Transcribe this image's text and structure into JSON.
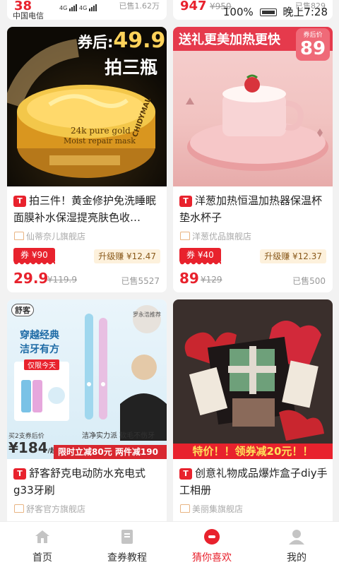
{
  "status_bar": {
    "carrier": "中国电信",
    "signal_1": "4G",
    "signal_2": "4G",
    "battery": "100%",
    "time": "晚上7:28"
  },
  "peek_row": [
    {
      "price": "38",
      "sold": "已售1.62万"
    },
    {
      "price": "947",
      "old_price": "¥950",
      "sold": "已售829"
    }
  ],
  "products": [
    {
      "title": "拍三件！黄金修护免洗睡眠面膜补水保湿提亮肤色收…",
      "shop": "仙蒂奈儿旗舰店",
      "coupon": "券 ¥90",
      "earn": "升级赚 ¥12.47",
      "price": "29.9",
      "old_price": "¥119.9",
      "sold": "已售5527",
      "banner_text_1": "券后:",
      "banner_text_2": "49.9",
      "banner_text_3": "拍三瓶",
      "jar_text": "24k pure gold",
      "jar_text_2": "Moist repair mask",
      "jar_brand": "CHIDYMAL"
    },
    {
      "title": "洋葱加热恒温加热器保温杯垫水杯子",
      "shop": "洋葱优品旗舰店",
      "coupon": "券 ¥40",
      "earn": "升级赚 ¥12.37",
      "price": "89",
      "old_price": "¥129",
      "sold": "已售500",
      "banner_text_1": "送礼更美加热更快",
      "badge_small": "券后价",
      "badge_big": "89"
    },
    {
      "title": "舒客舒克电动防水充电式g33牙刷",
      "shop": "舒客官方旗舰店",
      "banner_brand": "舒客",
      "banner_text_1": "穿越经典",
      "banner_text_2": "洁牙有方",
      "banner_text_3": "仅限今天",
      "banner_text_4": "买2支券后价",
      "banner_price": "¥184",
      "banner_price_unit": "/起",
      "banner_strip": "限时立减80元  两件减190",
      "banner_caption": "洁净实力派  软毛不伤牙",
      "banner_badge": "罗永浩推荐"
    },
    {
      "title": "创意礼物成品爆炸盒子diy手工相册",
      "shop": "美丽集旗舰店",
      "banner_strip": "特价！！领券减20元！！"
    }
  ],
  "tabbar": [
    {
      "label": "首页",
      "icon": "home-icon"
    },
    {
      "label": "查券教程",
      "icon": "book-icon"
    },
    {
      "label": "猜你喜欢",
      "icon": "guess-icon",
      "active": true
    },
    {
      "label": "我的",
      "icon": "user-icon"
    }
  ],
  "colors": {
    "accent": "#e8222d",
    "earn_bg": "#fdf1dc"
  }
}
